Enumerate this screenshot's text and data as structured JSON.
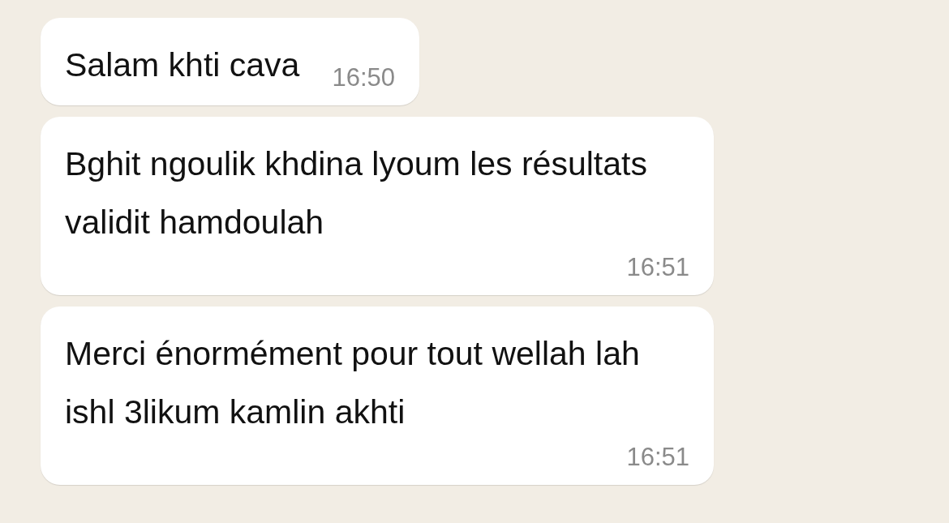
{
  "messages": [
    {
      "text": "Salam khti cava",
      "time": "16:50"
    },
    {
      "text": "Bghit ngoulik khdina lyoum les résultats validit hamdoulah",
      "time": "16:51"
    },
    {
      "text": "Merci énormément pour tout wellah lah ishl 3likum kamlin akhti",
      "time": "16:51"
    }
  ]
}
